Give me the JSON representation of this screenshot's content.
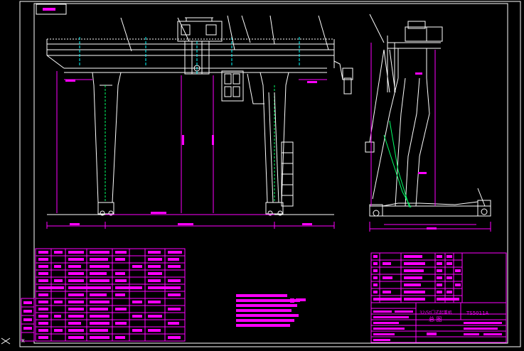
{
  "colors": {
    "background": "#000000",
    "frame": "#ffffff",
    "structure": "#ffffff",
    "dimension": "#ff00ff",
    "centerline": "#00ffff",
    "hidden": "#00ff66",
    "text": "#ff00ff"
  },
  "title_block": {
    "drawing_number": "TS5011A",
    "drawing_name": "总 图",
    "crane_name": "32/5t门式起重机"
  },
  "tags": {
    "top_left": "",
    "bottom_left": "X"
  },
  "dimensions": {
    "span_total": "18000",
    "left_cantilever": "7500",
    "right_cantilever": "7500",
    "lift_height": "11000"
  }
}
